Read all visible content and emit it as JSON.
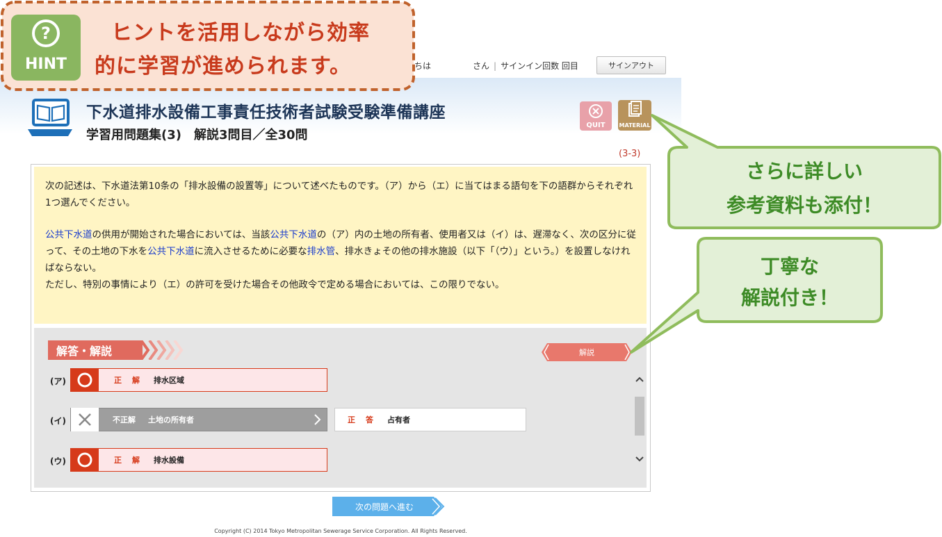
{
  "topbar": {
    "greeting_fragment": "ちは",
    "user_suffix": "さん",
    "signin_count_label": "サインイン回数 回目",
    "signout_label": "サインアウト"
  },
  "header": {
    "course_title": "下水道排水設備工事責任技術者試験受験準備講座",
    "subtitle": "学習用問題集(3)　解説3問目／全30問",
    "quit_label": "QUIT",
    "material_label": "MATERIAL",
    "page_counter": "(3-3)"
  },
  "question": {
    "intro": "次の記述は、下水道法第10条の「排水設備の設置等」について述べたものです。（ア）から（エ）に当てはまる語句を下の語群からそれぞれ1つ選んでください。",
    "p1_seg1": "公共下水道",
    "p1_seg2": "の供用が開始された場合においては、当該",
    "p1_seg3": "公共下水道",
    "p1_seg4": "の（ア）内の土地の所有者、使用者又は（イ）は、遅滞なく、次の区分に従って、その土地の下水を",
    "p1_seg5": "公共下水道",
    "p1_seg6": "に流入させるために必要な",
    "p1_seg7": "排水管",
    "p1_seg8": "、排水きょその他の排水施設（以下「（ウ）」という。）を設置しなければならない。",
    "p2": "ただし、特別の事情により（エ）の許可を受けた場合その他政令で定める場合においては、この限りでない。"
  },
  "answers": {
    "section_title": "解答・解説",
    "explain_label": "解説",
    "rows": [
      {
        "label": "(ア)",
        "result": "正　解",
        "answer": "排水区域"
      },
      {
        "label": "(イ)",
        "result": "不正解",
        "answer": "土地の所有者",
        "correct_label": "正　答",
        "correct_answer": "占有者"
      },
      {
        "label": "(ウ)",
        "result": "正　解",
        "answer": "排水設備"
      }
    ]
  },
  "footer": {
    "next_label": "次の問題へ進む",
    "copyright": "Copyright (C) 2014 Tokyo Metropolitan Sewerage Service Corporation. All Rights Reserved."
  },
  "promo": {
    "hint_badge": "HINT",
    "hint_symbol": "?",
    "hint_line1": "ヒントを活用しながら効率",
    "hint_line2": "的に学習が進められます。",
    "bubble1_line1": "さらに詳しい",
    "bubble1_line2": "参考資料も添付！",
    "bubble2_line1": "丁寧な",
    "bubble2_line2": "解説付き！"
  },
  "colors": {
    "accent_red": "#e06a5e",
    "correct_red": "#d63a1a",
    "wrong_gray": "#9e9e9e",
    "question_bg": "#fff5c4",
    "promo_green": "#3d8b26",
    "hint_orange": "#c83a1c",
    "next_blue": "#5cb0ea"
  }
}
